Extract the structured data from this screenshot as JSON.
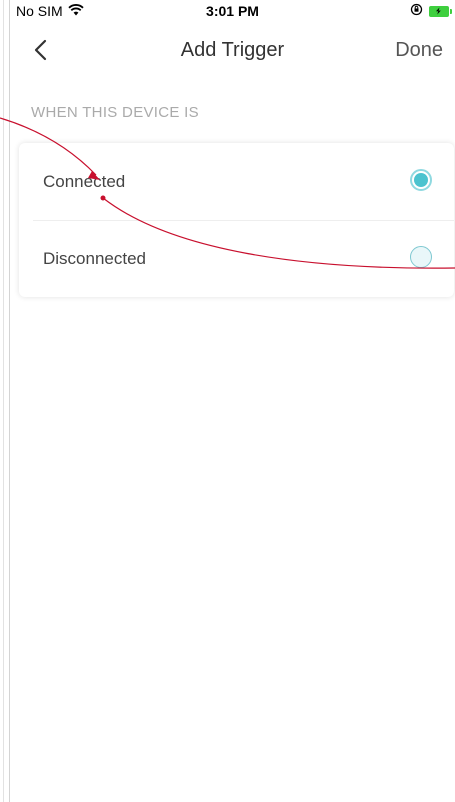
{
  "status_bar": {
    "carrier": "No SIM",
    "time": "3:01 PM"
  },
  "nav": {
    "title": "Add Trigger",
    "done_label": "Done"
  },
  "section": {
    "header": "WHEN THIS DEVICE IS"
  },
  "options": [
    {
      "label": "Connected",
      "selected": true
    },
    {
      "label": "Disconnected",
      "selected": false
    }
  ],
  "colors": {
    "accent": "#4cc3cf",
    "annotation": "#c8102e"
  }
}
